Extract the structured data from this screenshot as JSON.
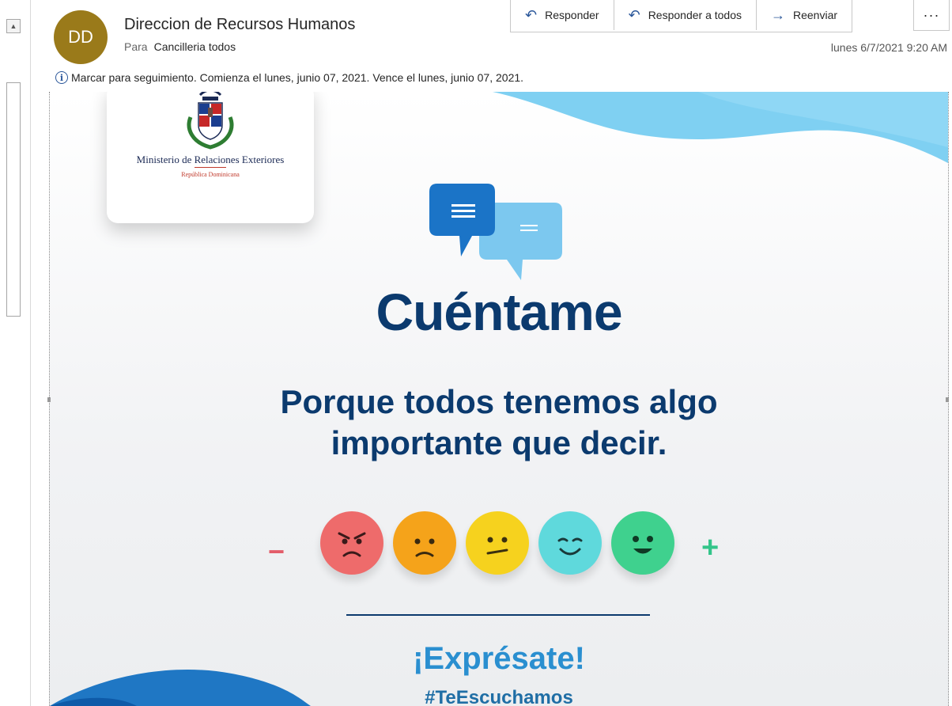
{
  "header": {
    "avatar_initials": "DD",
    "avatar_color": "#9a7a1a",
    "sender": "Direccion de Recursos Humanos",
    "to_label": "Para",
    "to_value": "Cancilleria todos",
    "date": "lunes 6/7/2021 9:20 AM",
    "followup": "Marcar para seguimiento.  Comienza el lunes, junio 07, 2021.  Vence el lunes, junio 07, 2021."
  },
  "actions": {
    "reply": "Responder",
    "reply_all": "Responder a todos",
    "forward": "Reenviar",
    "more": "···"
  },
  "flyer": {
    "logo_text": "Ministerio de Relaciones Exteriores",
    "logo_subtext": "República Dominicana",
    "title": "Cuéntame",
    "subtitle_line1": "Porque todos tenemos algo",
    "subtitle_line2": "importante que decir.",
    "minus": "−",
    "plus": "+",
    "faces": [
      "angry-face-icon",
      "sad-face-icon",
      "neutral-face-icon",
      "content-face-icon",
      "happy-face-icon"
    ],
    "cta": "¡Exprésate!",
    "hashtag": "#TeEscuchamos"
  },
  "colors": {
    "accent": "#2b579a",
    "navy": "#0b3a6e",
    "light_blue": "#2a8fd0"
  }
}
